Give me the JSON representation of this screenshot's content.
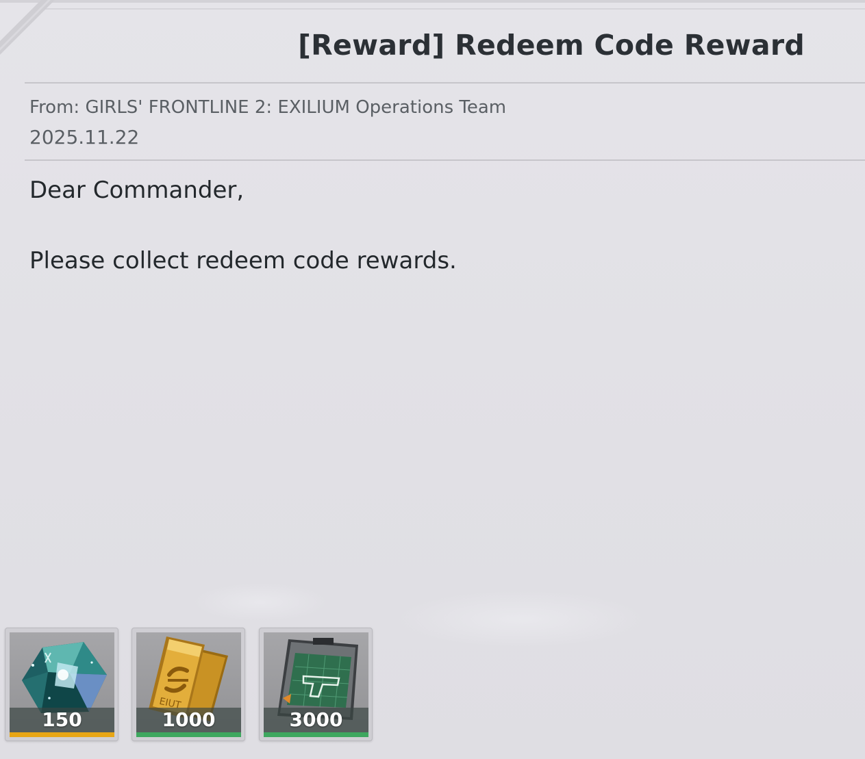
{
  "mail": {
    "title": "[Reward] Redeem Code Reward",
    "sender": "From: GIRLS' FRONTLINE 2: EXILIUM Operations Team",
    "date": "2025.11.22",
    "body": [
      "Dear Commander,",
      "Please collect redeem code rewards."
    ]
  },
  "rewards": [
    {
      "icon": "crystal-gem-icon",
      "quantity": "150",
      "rarity_color": "#e8a615"
    },
    {
      "icon": "gold-bar-icon",
      "quantity": "1000",
      "rarity_color": "#3ea75f"
    },
    {
      "icon": "weapon-blueprint-icon",
      "quantity": "3000",
      "rarity_color": "#3ea75f"
    }
  ]
}
